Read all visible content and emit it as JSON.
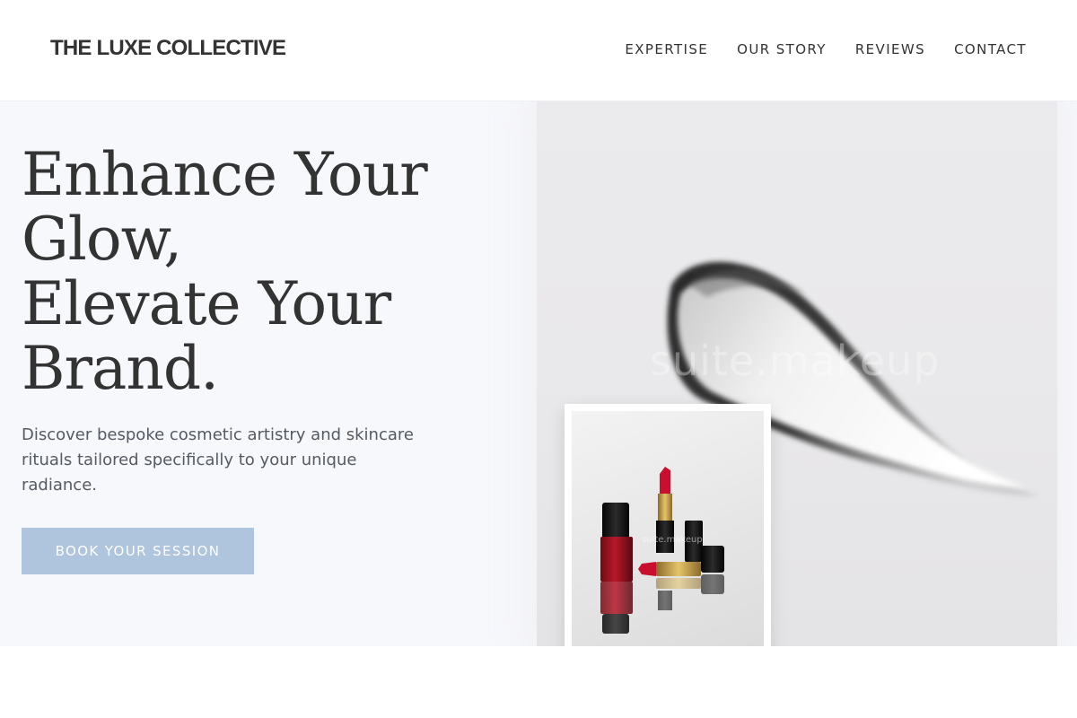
{
  "header": {
    "logo": "THE LUXE COLLECTIVE",
    "nav": [
      {
        "label": "EXPERTISE"
      },
      {
        "label": "OUR STORY"
      },
      {
        "label": "REVIEWS"
      },
      {
        "label": "CONTACT"
      }
    ]
  },
  "hero": {
    "headline_lines": [
      "Enhance Your",
      "Glow,",
      "Elevate Your",
      "Brand."
    ],
    "tagline": "Discover bespoke cosmetic artistry and skincare rituals tailored specifically to your unique radiance.",
    "cta_label": "BOOK YOUR SESSION",
    "main_image_watermark": "suite.makeup",
    "inset_image_watermark": "suite.makeup"
  },
  "colors": {
    "text": "#333333",
    "hero_background": "#f7f8fc",
    "cta_background": "#afc4dd",
    "cta_text": "#ffffff"
  }
}
